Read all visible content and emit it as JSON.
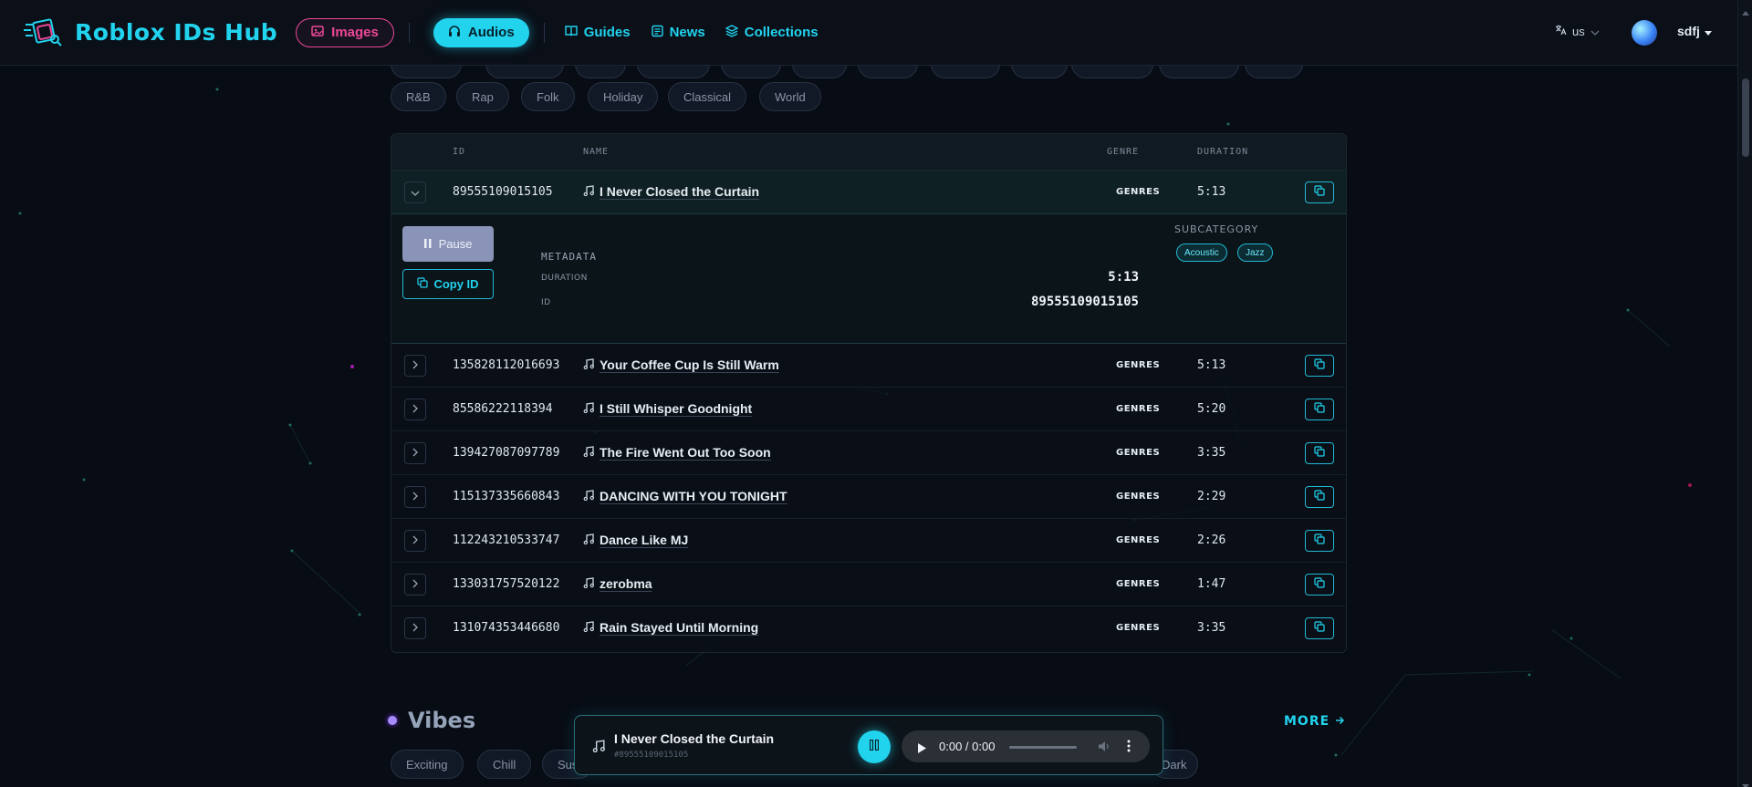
{
  "header": {
    "brand": "Roblox IDs Hub",
    "nav": {
      "images": "Images",
      "audios": "Audios",
      "guides": "Guides",
      "news": "News",
      "collections": "Collections"
    },
    "language": "us",
    "username": "sdfj"
  },
  "genre_chips": [
    "R&B",
    "Rap",
    "Folk",
    "Holiday",
    "Classical",
    "World"
  ],
  "table": {
    "columns": {
      "id": "ID",
      "name": "NAME",
      "genre": "GENRE",
      "duration": "DURATION"
    },
    "rows": [
      {
        "id": "89555109015105",
        "name": "I Never Closed the Curtain",
        "genre": "GENRES",
        "duration": "5:13",
        "expanded": true
      },
      {
        "id": "135828112016693",
        "name": "Your Coffee Cup Is Still Warm",
        "genre": "GENRES",
        "duration": "5:13"
      },
      {
        "id": "85586222118394",
        "name": "I Still Whisper Goodnight",
        "genre": "GENRES",
        "duration": "5:20"
      },
      {
        "id": "139427087097789",
        "name": "The Fire Went Out Too Soon",
        "genre": "GENRES",
        "duration": "3:35"
      },
      {
        "id": "115137335660843",
        "name": "DANCING WITH YOU TONIGHT",
        "genre": "GENRES",
        "duration": "2:29"
      },
      {
        "id": "112243210533747",
        "name": "Dance Like MJ",
        "genre": "GENRES",
        "duration": "2:26"
      },
      {
        "id": "133031757520122",
        "name": "zerobma",
        "genre": "GENRES",
        "duration": "1:47"
      },
      {
        "id": "131074353446680",
        "name": "Rain Stayed Until Morning",
        "genre": "GENRES",
        "duration": "3:35"
      }
    ],
    "expanded": {
      "pause_label": "Pause",
      "copy_id_label": "Copy ID",
      "metadata_title": "METADATA",
      "duration_label": "DURATION",
      "duration_value": "5:13",
      "id_label": "ID",
      "id_value": "89555109015105",
      "subcategory_title": "SUBCATEGORY",
      "subcategories": [
        "Acoustic",
        "Jazz"
      ]
    }
  },
  "vibes": {
    "title": "Vibes",
    "more_label": "MORE",
    "chips": [
      "Exciting",
      "Chill",
      "Sus",
      "Dark"
    ]
  },
  "player": {
    "title": "I Never Closed the Curtain",
    "id": "#89555109015105",
    "time": "0:00 / 0:00"
  },
  "colors": {
    "accent": "#22d3ee",
    "images_pink": "#ec4899",
    "background": "#080c14"
  }
}
